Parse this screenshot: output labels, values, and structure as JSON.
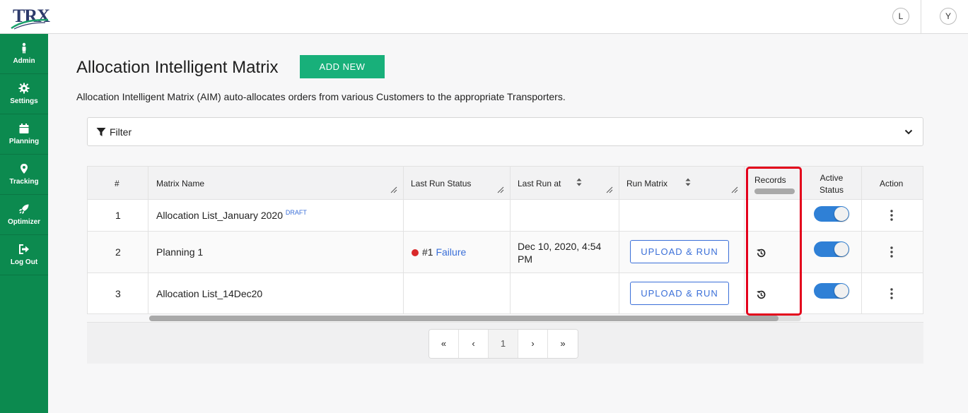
{
  "header": {
    "logo_text": "TRX",
    "avatar_left": "L",
    "avatar_right": "Y"
  },
  "sidebar": {
    "items": [
      {
        "label": "Admin",
        "icon": "person-icon"
      },
      {
        "label": "Settings",
        "icon": "gear-icon"
      },
      {
        "label": "Planning",
        "icon": "calendar-icon"
      },
      {
        "label": "Tracking",
        "icon": "location-pin-icon"
      },
      {
        "label": "Optimizer",
        "icon": "rocket-icon"
      },
      {
        "label": "Log Out",
        "icon": "logout-icon"
      }
    ]
  },
  "page": {
    "title": "Allocation Intelligent Matrix",
    "add_new_label": "ADD NEW",
    "description": "Allocation Intelligent Matrix (AIM) auto-allocates orders from various Customers to the appropriate Transporters."
  },
  "filter": {
    "label": "Filter"
  },
  "table": {
    "columns": {
      "index": "#",
      "matrix_name": "Matrix Name",
      "last_run_status": "Last Run Status",
      "last_run_at": "Last Run at",
      "run_matrix": "Run Matrix",
      "records": "Records",
      "active_status": "Active Status",
      "action": "Action"
    },
    "rows": [
      {
        "index": "1",
        "name": "Allocation List_January 2020",
        "badge": "DRAFT",
        "status_prefix": "",
        "status_link": "",
        "last_run_at": "",
        "run_label": "",
        "active": true
      },
      {
        "index": "2",
        "name": "Planning 1",
        "badge": "",
        "status_prefix": "#1",
        "status_link": "Failure",
        "last_run_at": "Dec 10, 2020, 4:54 PM",
        "run_label": "UPLOAD & RUN",
        "active": true
      },
      {
        "index": "3",
        "name": "Allocation List_14Dec20",
        "badge": "",
        "status_prefix": "",
        "status_link": "",
        "last_run_at": "",
        "run_label": "UPLOAD & RUN",
        "active": true
      }
    ]
  },
  "pagination": {
    "first": "«",
    "prev": "‹",
    "current": "1",
    "next": "›",
    "last": "»"
  },
  "colors": {
    "sidebar": "#0c8a4f",
    "primary_button": "#18b07a",
    "link": "#3a6fd8",
    "toggle_on": "#2f80d6",
    "highlight": "#e3001b",
    "failure_dot": "#d9292b"
  }
}
